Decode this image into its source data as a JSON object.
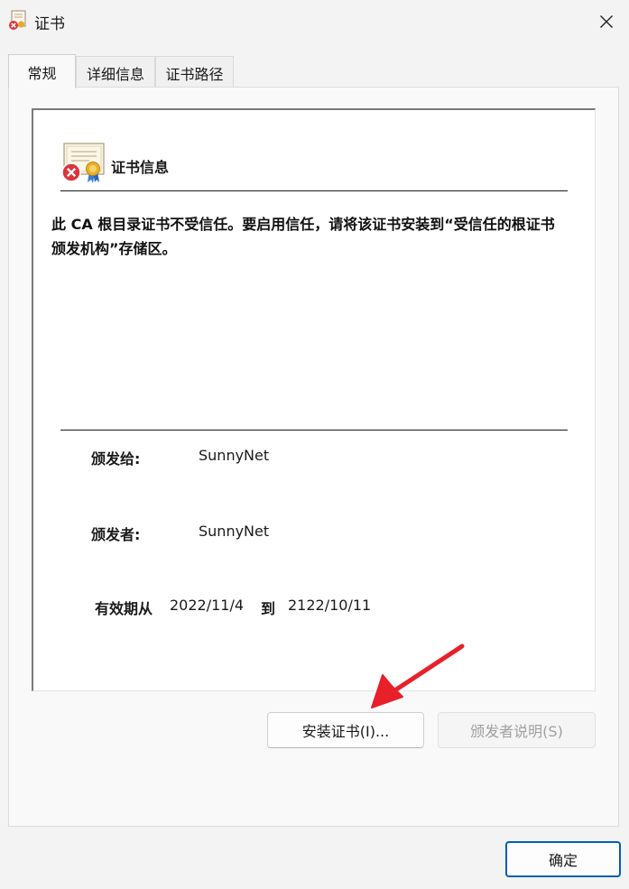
{
  "window": {
    "title": "证书",
    "icon": "certificate-error-icon",
    "close_icon": "close-icon"
  },
  "tabs": [
    {
      "label": "常规",
      "active": true
    },
    {
      "label": "详细信息",
      "active": false
    },
    {
      "label": "证书路径",
      "active": false
    }
  ],
  "info": {
    "section_title": "证书信息",
    "warning": "此 CA 根目录证书不受信任。要启用信任，请将该证书安装到“受信任的根证书颁发机构”存储区。",
    "issued_to_label": "颁发给:",
    "issued_to_value": "SunnyNet",
    "issued_by_label": "颁发者:",
    "issued_by_value": "SunnyNet",
    "valid_from_label": "有效期从",
    "valid_from_value": "2022/11/4",
    "valid_to_label": "到",
    "valid_to_value": "2122/10/11"
  },
  "buttons": {
    "install": "安装证书(I)...",
    "issuer_statement": "颁发者说明(S)",
    "ok": "确定"
  },
  "colors": {
    "accent": "#005fb8",
    "annotation_arrow": "#e8202a",
    "error_badge": "#d9363e"
  }
}
